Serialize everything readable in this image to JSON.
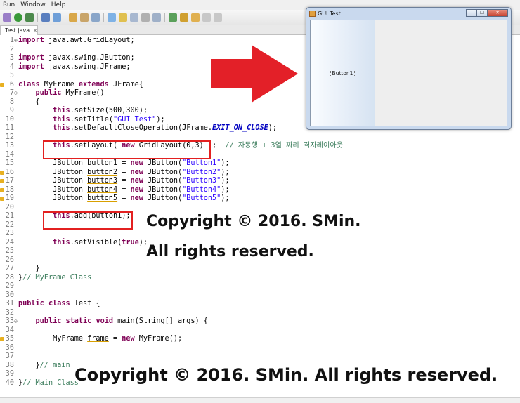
{
  "menu": [
    "Run",
    "Window",
    "Help"
  ],
  "editor_tab": {
    "label": "Test.java",
    "close": "✕"
  },
  "code_lines": [
    {
      "n": "1",
      "fold": "⊕",
      "html": "<span class='kw'>import</span> java.awt.GridLayout;"
    },
    {
      "n": "2",
      "html": ""
    },
    {
      "n": "3",
      "html": "<span class='kw'>import</span> javax.swing.JButton;"
    },
    {
      "n": "4",
      "html": "<span class='kw'>import</span> javax.swing.JFrame;"
    },
    {
      "n": "5",
      "html": ""
    },
    {
      "n": "6",
      "warn": true,
      "html": "<span class='kw'>class</span> MyFrame <span class='kw'>extends</span> JFrame{"
    },
    {
      "n": "7",
      "fold": "⊖",
      "html": "    <span class='kw'>public</span> MyFrame()"
    },
    {
      "n": "8",
      "html": "    {"
    },
    {
      "n": "9",
      "html": "        <span class='kw'>this</span>.setSize(500,300);"
    },
    {
      "n": "10",
      "html": "        <span class='kw'>this</span>.setTitle(<span class='str'>\"GUI Test\"</span>);"
    },
    {
      "n": "11",
      "html": "        <span class='kw'>this</span>.setDefaultCloseOperation(JFrame.<span class='fld'>EXIT_ON_CLOSE</span>);"
    },
    {
      "n": "12",
      "html": ""
    },
    {
      "n": "13",
      "html": "        <span class='kw'>this</span>.setLayout( <span class='kw'>new</span> GridLayout(0,3) );  <span class='cm'>// 자동행 + 3열 짜리 격자레이아웃</span>"
    },
    {
      "n": "14",
      "html": ""
    },
    {
      "n": "15",
      "html": "        JButton button1 = <span class='kw'>new</span> JButton(<span class='str'>\"Button1\"</span>);"
    },
    {
      "n": "16",
      "warn": true,
      "html": "        JButton <span class='ul'>button2</span> = <span class='kw'>new</span> JButton(<span class='str'>\"Button2\"</span>);"
    },
    {
      "n": "17",
      "warn": true,
      "html": "        JButton <span class='ul'>button3</span> = <span class='kw'>new</span> JButton(<span class='str'>\"Button3\"</span>);"
    },
    {
      "n": "18",
      "warn": true,
      "html": "        JButton <span class='ul'>button4</span> = <span class='kw'>new</span> JButton(<span class='str'>\"Button4\"</span>);"
    },
    {
      "n": "19",
      "warn": true,
      "html": "        JButton <span class='ul'>button5</span> = <span class='kw'>new</span> JButton(<span class='str'>\"Button5\"</span>);"
    },
    {
      "n": "20",
      "html": ""
    },
    {
      "n": "21",
      "html": "        <span class='kw'>this</span>.add(button1);"
    },
    {
      "n": "22",
      "html": ""
    },
    {
      "n": "23",
      "html": ""
    },
    {
      "n": "24",
      "html": "        <span class='kw'>this</span>.setVisible(<span class='kw'>true</span>);"
    },
    {
      "n": "25",
      "html": ""
    },
    {
      "n": "26",
      "html": ""
    },
    {
      "n": "27",
      "html": "    }"
    },
    {
      "n": "28",
      "html": "}<span class='cm'>// MyFrame Class</span>"
    },
    {
      "n": "29",
      "html": ""
    },
    {
      "n": "30",
      "html": ""
    },
    {
      "n": "31",
      "html": "<span class='kw'>public</span> <span class='kw'>class</span> Test {"
    },
    {
      "n": "32",
      "html": ""
    },
    {
      "n": "33",
      "fold": "⊖",
      "html": "    <span class='kw'>public</span> <span class='kw'>static</span> <span class='kw'>void</span> main(String[] args) {"
    },
    {
      "n": "34",
      "html": ""
    },
    {
      "n": "35",
      "warn": true,
      "html": "        MyFrame <span class='ul'>frame</span> = <span class='kw'>new</span> MyFrame();"
    },
    {
      "n": "36",
      "html": ""
    },
    {
      "n": "37",
      "html": ""
    },
    {
      "n": "38",
      "html": "    }<span class='cm'>// main</span>"
    },
    {
      "n": "39",
      "html": ""
    },
    {
      "n": "40",
      "html": "}<span class='cm'>// Main Class</span>"
    }
  ],
  "gui_window": {
    "title": "GUI Test",
    "button_label": "Button1",
    "controls": [
      "—",
      "☐",
      "✕"
    ]
  },
  "overlays": {
    "copyright_line1": "Copyright © 2016. SMin.",
    "copyright_line2": "All rights reserved.",
    "copyright_bottom": "Copyright © 2016. SMin. All rights reserved."
  },
  "colors": {
    "highlight_red": "#e32020",
    "arrow_red": "#e32028",
    "keyword": "#7f0055",
    "string": "#2a00ff",
    "comment": "#3f7f5f"
  }
}
